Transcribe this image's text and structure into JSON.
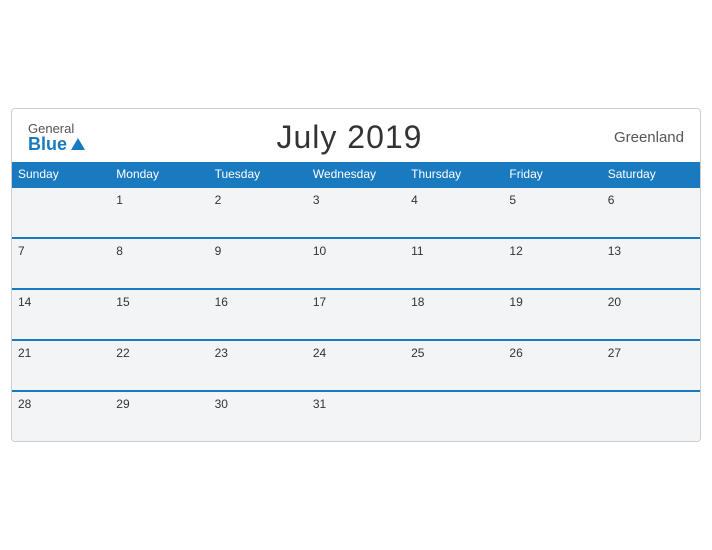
{
  "header": {
    "logo_general": "General",
    "logo_blue": "Blue",
    "title": "July 2019",
    "region": "Greenland"
  },
  "days_of_week": [
    "Sunday",
    "Monday",
    "Tuesday",
    "Wednesday",
    "Thursday",
    "Friday",
    "Saturday"
  ],
  "weeks": [
    [
      "",
      "1",
      "2",
      "3",
      "4",
      "5",
      "6"
    ],
    [
      "7",
      "8",
      "9",
      "10",
      "11",
      "12",
      "13"
    ],
    [
      "14",
      "15",
      "16",
      "17",
      "18",
      "19",
      "20"
    ],
    [
      "21",
      "22",
      "23",
      "24",
      "25",
      "26",
      "27"
    ],
    [
      "28",
      "29",
      "30",
      "31",
      "",
      "",
      ""
    ]
  ]
}
